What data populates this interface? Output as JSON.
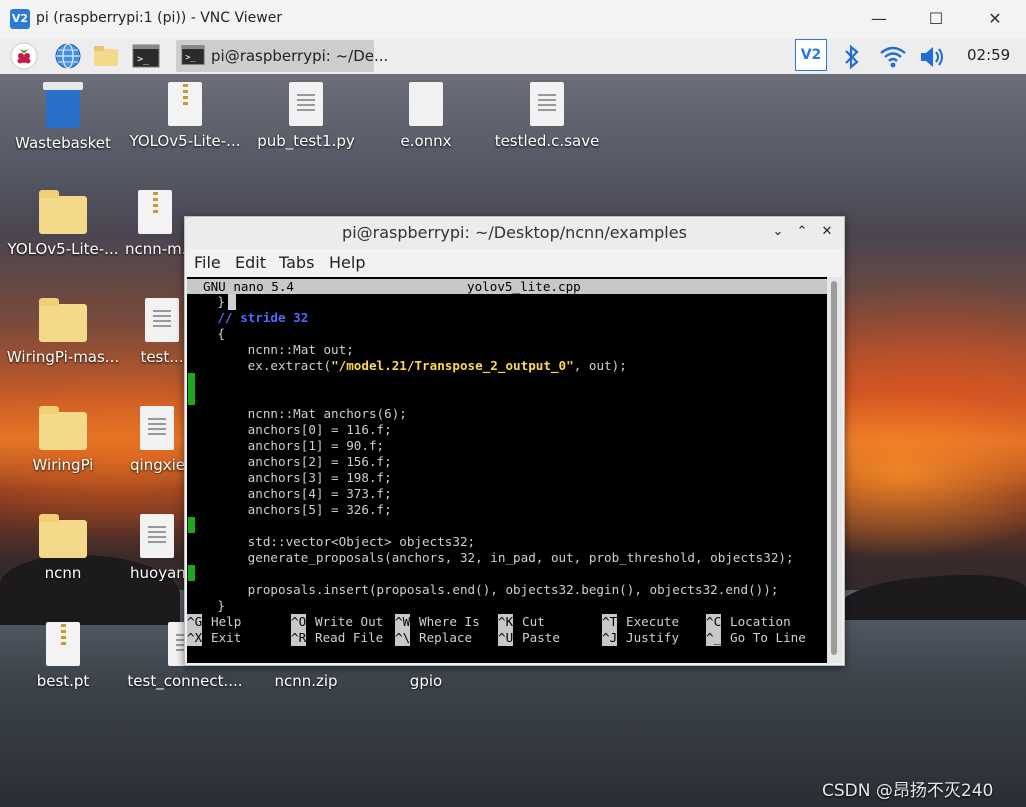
{
  "vnc_window": {
    "logo_text": "V2",
    "title": "pi (raspberrypi:1 (pi)) - VNC Viewer",
    "minimize": "—",
    "maximize": "☐",
    "close": "✕"
  },
  "taskbar": {
    "active_task": "pi@raspberrypi: ~/De...",
    "tray_vnc_text": "V2",
    "clock": "02:59",
    "icons": [
      "raspberry-menu-icon",
      "browser-icon",
      "file-manager-icon",
      "terminal-icon",
      "bluetooth-icon",
      "wifi-icon",
      "volume-icon"
    ]
  },
  "desktop": {
    "icons": [
      {
        "label": "Wastebasket",
        "type": "bin"
      },
      {
        "label": "YOLOv5-Lite-...",
        "type": "zip"
      },
      {
        "label": "pub_test1.py",
        "type": "doc"
      },
      {
        "label": "e.onnx",
        "type": "plain"
      },
      {
        "label": "testled.c.save",
        "type": "doc"
      },
      {
        "label": "YOLOv5-Lite-...",
        "type": "folder"
      },
      {
        "label": "ncnn-m...",
        "type": "zip"
      },
      {
        "label": "WiringPi-mas...",
        "type": "folder"
      },
      {
        "label": "test...",
        "type": "doc"
      },
      {
        "label": "WiringPi",
        "type": "folder"
      },
      {
        "label": "qingxie...",
        "type": "doc"
      },
      {
        "label": "ncnn",
        "type": "folder"
      },
      {
        "label": "huoyan...",
        "type": "doc"
      },
      {
        "label": "best.pt",
        "type": "zip"
      },
      {
        "label": "test_connect....",
        "type": "doc"
      },
      {
        "label": "ncnn.zip",
        "type": "zip"
      },
      {
        "label": "gpio",
        "type": "plain"
      }
    ]
  },
  "terminal": {
    "title": "pi@raspberrypi: ~/Desktop/ncnn/examples",
    "menu": [
      "File",
      "Edit",
      "Tabs",
      "Help"
    ],
    "nano_version": "GNU nano 5.4",
    "filename": "yolov5_lite.cpp",
    "lines": [
      {
        "pre": "    }",
        "kw": "",
        "str": "",
        "post": ""
      },
      {
        "pre": "    ",
        "kw": "// stride 32",
        "str": "",
        "post": ""
      },
      {
        "pre": "    {",
        "kw": "",
        "str": "",
        "post": ""
      },
      {
        "pre": "        ncnn::Mat out;",
        "kw": "",
        "str": "",
        "post": ""
      },
      {
        "pre": "        ex.extract(",
        "kw": "",
        "str": "\"/model.21/Transpose_2_output_0\"",
        "post": ", out);"
      },
      {
        "pre": "",
        "kw": "",
        "str": "",
        "post": ""
      },
      {
        "pre": "",
        "kw": "",
        "str": "",
        "post": ""
      },
      {
        "pre": "        ncnn::Mat anchors(6);",
        "kw": "",
        "str": "",
        "post": ""
      },
      {
        "pre": "        anchors[0] = 116.f;",
        "kw": "",
        "str": "",
        "post": ""
      },
      {
        "pre": "        anchors[1] = 90.f;",
        "kw": "",
        "str": "",
        "post": ""
      },
      {
        "pre": "        anchors[2] = 156.f;",
        "kw": "",
        "str": "",
        "post": ""
      },
      {
        "pre": "        anchors[3] = 198.f;",
        "kw": "",
        "str": "",
        "post": ""
      },
      {
        "pre": "        anchors[4] = 373.f;",
        "kw": "",
        "str": "",
        "post": ""
      },
      {
        "pre": "        anchors[5] = 326.f;",
        "kw": "",
        "str": "",
        "post": ""
      },
      {
        "pre": "",
        "kw": "",
        "str": "",
        "post": ""
      },
      {
        "pre": "        std::vector<Object> objects32;",
        "kw": "",
        "str": "",
        "post": ""
      },
      {
        "pre": "        generate_proposals(anchors, 32, in_pad, out, prob_threshold, objects32);",
        "kw": "",
        "str": "",
        "post": ""
      },
      {
        "pre": "",
        "kw": "",
        "str": "",
        "post": ""
      },
      {
        "pre": "        proposals.insert(proposals.end(), objects32.begin(), objects32.end());",
        "kw": "",
        "str": "",
        "post": ""
      },
      {
        "pre": "    }",
        "kw": "",
        "str": "",
        "post": ""
      }
    ],
    "shortcuts": [
      {
        "key": "^G",
        "label": "Help"
      },
      {
        "key": "^O",
        "label": "Write Out"
      },
      {
        "key": "^W",
        "label": "Where Is"
      },
      {
        "key": "^K",
        "label": "Cut"
      },
      {
        "key": "^T",
        "label": "Execute"
      },
      {
        "key": "^C",
        "label": "Location"
      },
      {
        "key": "^X",
        "label": "Exit"
      },
      {
        "key": "^R",
        "label": "Read File"
      },
      {
        "key": "^\\",
        "label": "Replace"
      },
      {
        "key": "^U",
        "label": "Paste"
      },
      {
        "key": "^J",
        "label": "Justify"
      },
      {
        "key": "^_",
        "label": "Go To Line"
      }
    ]
  },
  "watermark": "CSDN @昂扬不灭240",
  "colors": {
    "keyword": "#4b6bff",
    "string": "#ffd84a",
    "gutter_marker": "#1ca81c",
    "accent": "#2a7ad6"
  }
}
